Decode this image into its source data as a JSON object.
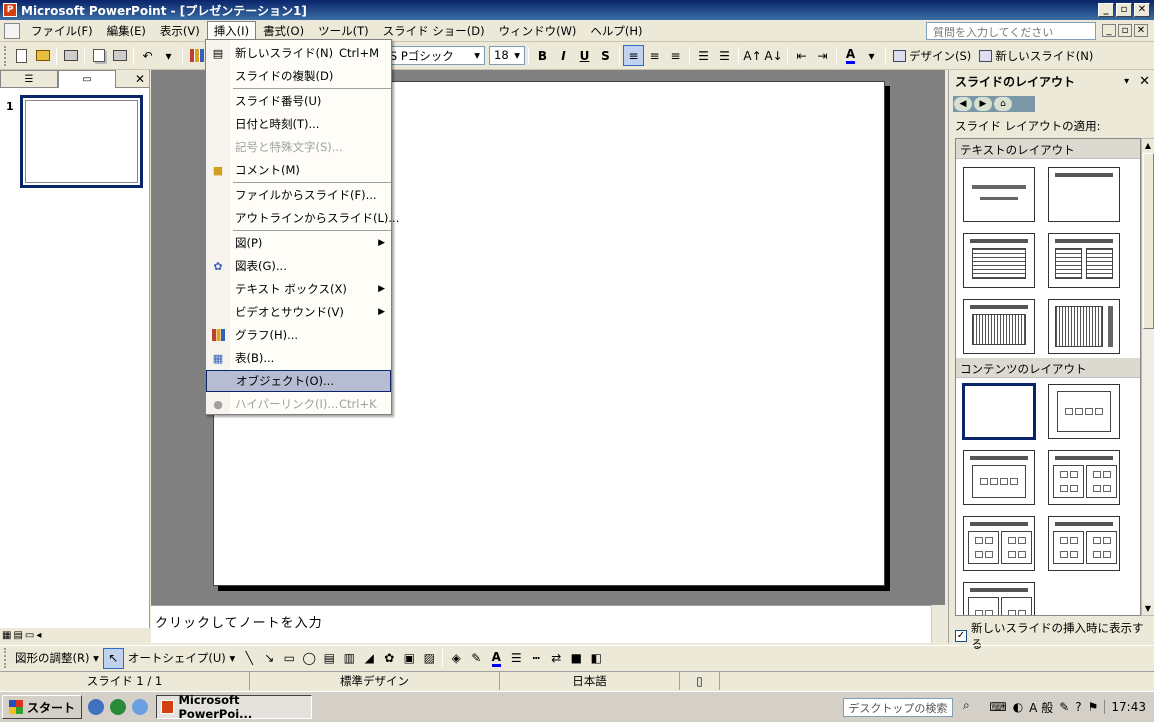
{
  "window": {
    "title": "Microsoft PowerPoint - [プレゼンテーション1]",
    "buttons": [
      "_",
      "▫",
      "✕"
    ]
  },
  "menubar": {
    "items": [
      "ファイル(F)",
      "編集(E)",
      "表示(V)",
      "挿入(I)",
      "書式(O)",
      "ツール(T)",
      "スライド ショー(D)",
      "ウィンドウ(W)",
      "ヘルプ(H)"
    ],
    "help_placeholder": "質問を入力してください",
    "doc_buttons": [
      "_",
      "▫",
      "✕"
    ]
  },
  "toolbar": {
    "font_name": "MS Pゴシック",
    "font_size": "18",
    "format": [
      "B",
      "I",
      "U",
      "S"
    ],
    "design_label": "デザイン(S)",
    "new_slide_label": "新しいスライド(N)"
  },
  "insert_menu": {
    "items": [
      {
        "label": "新しいスライド(N)",
        "shortcut": "Ctrl+M",
        "icon": "new-slide-icon"
      },
      {
        "label": "スライドの複製(D)"
      },
      {
        "label": "スライド番号(U)"
      },
      {
        "label": "日付と時刻(T)..."
      },
      {
        "label": "記号と特殊文字(S)...",
        "disabled": true
      },
      {
        "label": "コメント(M)",
        "icon": "comment-icon"
      },
      {
        "label": "ファイルからスライド(F)..."
      },
      {
        "label": "アウトラインからスライド(L)..."
      },
      {
        "label": "図(P)",
        "submenu": true
      },
      {
        "label": "図表(G)...",
        "icon": "diagram-icon"
      },
      {
        "label": "テキスト ボックス(X)",
        "submenu": true
      },
      {
        "label": "ビデオとサウンド(V)",
        "submenu": true
      },
      {
        "label": "グラフ(H)...",
        "icon": "chart-icon"
      },
      {
        "label": "表(B)...",
        "icon": "table-icon"
      },
      {
        "label": "オブジェクト(O)...",
        "highlighted": true
      },
      {
        "label": "ハイパーリンク(I)...",
        "shortcut": "Ctrl+K",
        "disabled": true,
        "icon": "hyperlink-icon"
      }
    ]
  },
  "left_pane": {
    "tabs": [
      "outline-tab",
      "slides-tab"
    ],
    "slide_number": "1"
  },
  "notes": {
    "placeholder": "クリックしてノートを入力"
  },
  "task_pane": {
    "title": "スライドのレイアウト",
    "apply_label": "スライド レイアウトの適用:",
    "section_text": "テキストのレイアウト",
    "section_content": "コンテンツのレイアウト",
    "show_on_insert": "新しいスライドの挿入時に表示する"
  },
  "drawing_toolbar": {
    "draw_label": "図形の調整(R)",
    "autoshape_label": "オートシェイプ(U)"
  },
  "status": {
    "slide": "スライド 1 / 1",
    "design": "標準デザイン",
    "language": "日本語"
  },
  "taskbar": {
    "start": "スタート",
    "task": "Microsoft PowerPoi...",
    "search_placeholder": "デスクトップの検索",
    "clock": "17:43",
    "tray_text": "A 般"
  },
  "colors": {
    "titlebar": "#0a246a",
    "highlight": "#b6bdd2",
    "workspace": "#808080"
  }
}
